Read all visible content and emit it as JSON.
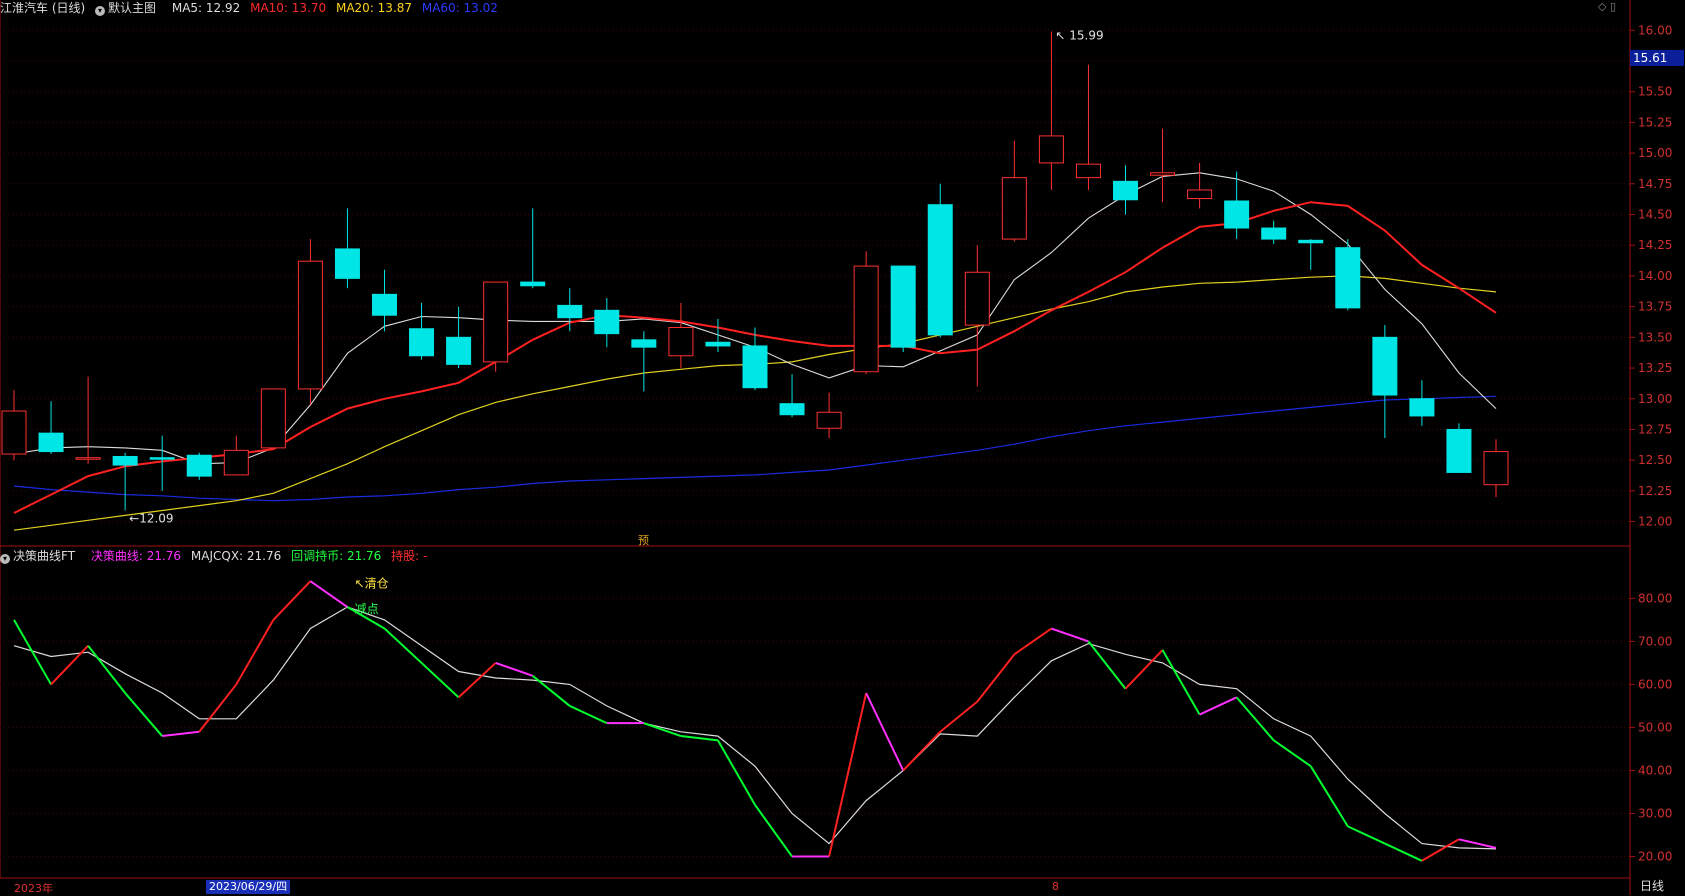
{
  "header_top": {
    "title": "江淮汽车 (日线)",
    "chart_mode": "默认主图",
    "ma5": "MA5: 12.92",
    "ma10": "MA10: 13.70",
    "ma20": "MA20: 13.87",
    "ma60": "MA60: 13.02"
  },
  "header_bottom": {
    "title": "决策曲线FT",
    "jc": "决策曲线: 21.76",
    "majcqx": "MAJCQX: 21.76",
    "hdcb": "回调持币: 21.76",
    "cg": "持股: -"
  },
  "current_price": "15.61",
  "period": "日线",
  "time_labels": {
    "year": "2023年",
    "date": "2023/06/29/四",
    "month": "8"
  },
  "marker_yu": "预",
  "colors": {
    "up": "#ff3030",
    "down": "#00e5e5",
    "ma5": "#dcdcdc",
    "ma10": "#ff2020",
    "ma20": "#e0d020",
    "ma60": "#1a2ae0",
    "grid": "#3a0808",
    "axis": "#a01010",
    "ind_up": "#ff2020",
    "ind_down": "#00ff30",
    "ind_flat": "#ff30ff",
    "ind_ma": "#dcdcdc"
  },
  "chart_data": [
    {
      "type": "candlestick",
      "y_ticks": [
        "16.00",
        "15.75",
        "15.50",
        "15.25",
        "15.00",
        "14.75",
        "14.50",
        "14.25",
        "14.00",
        "13.75",
        "13.50",
        "13.25",
        "13.00",
        "12.75",
        "12.50",
        "12.25",
        "12.00"
      ],
      "ylim": [
        11.85,
        16.1
      ],
      "candles": [
        [
          12.55,
          12.9,
          13.07,
          12.5
        ],
        [
          12.72,
          12.57,
          12.98,
          12.55
        ],
        [
          12.51,
          12.52,
          13.18,
          12.47
        ],
        [
          12.53,
          12.46,
          12.56,
          12.09
        ],
        [
          12.52,
          12.51,
          12.7,
          12.25
        ],
        [
          12.54,
          12.37,
          12.56,
          12.34
        ],
        [
          12.38,
          12.58,
          12.7,
          12.38
        ],
        [
          12.6,
          13.08,
          13.08,
          12.6
        ],
        [
          13.08,
          14.12,
          14.3,
          12.95
        ],
        [
          14.22,
          13.98,
          14.55,
          13.9
        ],
        [
          13.85,
          13.68,
          14.05,
          13.55
        ],
        [
          13.57,
          13.35,
          13.78,
          13.32
        ],
        [
          13.5,
          13.28,
          13.75,
          13.25
        ],
        [
          13.3,
          13.95,
          13.95,
          13.22
        ],
        [
          13.95,
          13.92,
          14.55,
          13.9
        ],
        [
          13.76,
          13.66,
          13.9,
          13.55
        ],
        [
          13.72,
          13.53,
          13.82,
          13.42
        ],
        [
          13.48,
          13.42,
          13.55,
          13.06
        ],
        [
          13.35,
          13.58,
          13.78,
          13.25
        ],
        [
          13.46,
          13.43,
          13.65,
          13.38
        ],
        [
          13.43,
          13.09,
          13.58,
          13.07
        ],
        [
          12.96,
          12.87,
          13.2,
          12.85
        ],
        [
          12.76,
          12.89,
          13.05,
          12.68
        ],
        [
          13.22,
          14.08,
          14.2,
          13.2
        ],
        [
          14.08,
          13.42,
          14.08,
          13.38
        ],
        [
          14.58,
          13.52,
          14.75,
          13.5
        ],
        [
          13.6,
          14.03,
          14.25,
          13.1
        ],
        [
          14.3,
          14.8,
          15.1,
          14.28
        ],
        [
          14.92,
          15.14,
          15.99,
          14.7
        ],
        [
          14.8,
          14.91,
          15.72,
          14.7
        ],
        [
          14.77,
          14.62,
          14.9,
          14.5
        ],
        [
          14.82,
          14.84,
          15.2,
          14.6
        ],
        [
          14.63,
          14.7,
          14.92,
          14.55
        ],
        [
          14.61,
          14.39,
          14.85,
          14.3
        ],
        [
          14.39,
          14.3,
          14.45,
          14.26
        ],
        [
          14.29,
          14.27,
          14.3,
          14.05
        ],
        [
          14.23,
          13.74,
          14.3,
          13.72
        ],
        [
          13.5,
          13.03,
          13.6,
          12.68
        ],
        [
          13.0,
          12.86,
          13.15,
          12.78
        ],
        [
          12.75,
          12.4,
          12.8,
          12.4
        ],
        [
          12.3,
          12.57,
          12.67,
          12.2
        ]
      ],
      "ma5": [
        12.55,
        12.6,
        12.61,
        12.6,
        12.58,
        12.47,
        12.48,
        12.6,
        12.95,
        13.37,
        13.59,
        13.67,
        13.66,
        13.64,
        13.63,
        13.63,
        13.63,
        13.65,
        13.62,
        13.52,
        13.42,
        13.28,
        13.17,
        13.27,
        13.26,
        13.39,
        13.52,
        13.97,
        14.19,
        14.47,
        14.66,
        14.81,
        14.84,
        14.79,
        14.69,
        14.5,
        14.26,
        13.89,
        13.61,
        13.21,
        12.92
      ],
      "ma10": [
        12.07,
        12.22,
        12.37,
        12.45,
        12.49,
        12.52,
        12.55,
        12.59,
        12.77,
        12.92,
        13.0,
        13.06,
        13.13,
        13.3,
        13.48,
        13.62,
        13.68,
        13.66,
        13.63,
        13.58,
        13.52,
        13.47,
        13.43,
        13.43,
        13.43,
        13.37,
        13.4,
        13.55,
        13.72,
        13.87,
        14.03,
        14.23,
        14.4,
        14.43,
        14.53,
        14.6,
        14.57,
        14.37,
        14.09,
        13.9,
        13.7
      ],
      "ma20": [
        11.93,
        11.97,
        12.01,
        12.05,
        12.09,
        12.13,
        12.17,
        12.23,
        12.35,
        12.47,
        12.61,
        12.74,
        12.87,
        12.97,
        13.04,
        13.1,
        13.16,
        13.21,
        13.24,
        13.27,
        13.28,
        13.3,
        13.36,
        13.41,
        13.45,
        13.52,
        13.59,
        13.66,
        13.73,
        13.79,
        13.87,
        13.91,
        13.94,
        13.95,
        13.97,
        13.99,
        14.0,
        13.98,
        13.94,
        13.9,
        13.87
      ],
      "ma60": [
        12.29,
        12.26,
        12.24,
        12.22,
        12.21,
        12.19,
        12.18,
        12.17,
        12.18,
        12.2,
        12.21,
        12.23,
        12.26,
        12.28,
        12.31,
        12.33,
        12.34,
        12.35,
        12.36,
        12.37,
        12.38,
        12.4,
        12.42,
        12.46,
        12.5,
        12.54,
        12.58,
        12.63,
        12.69,
        12.74,
        12.78,
        12.81,
        12.84,
        12.87,
        12.9,
        12.93,
        12.96,
        12.99,
        13.0,
        13.01,
        13.02
      ],
      "annotations": [
        {
          "text": "15.99",
          "index": 28,
          "price": 15.99
        },
        {
          "text": "12.09",
          "index": 3,
          "price": 12.09
        }
      ]
    },
    {
      "type": "line",
      "y_ticks": [
        "80.00",
        "70.00",
        "60.00",
        "50.00",
        "40.00",
        "30.00",
        "20.00"
      ],
      "ylim": [
        15,
        88
      ],
      "jc": [
        75,
        60,
        69,
        58,
        48,
        49,
        60,
        75,
        84,
        78,
        73,
        65,
        57,
        65,
        62,
        55,
        51,
        51,
        48,
        47,
        32,
        20,
        20,
        58,
        40,
        49,
        56,
        67,
        73,
        70,
        59,
        68,
        53,
        57,
        47,
        41,
        27,
        23,
        19,
        24,
        22
      ],
      "majcqx": [
        69,
        66.5,
        67.5,
        62.5,
        58,
        52,
        52,
        61,
        73,
        78,
        75,
        69,
        63,
        61.5,
        61,
        60,
        55,
        51,
        49,
        48,
        41,
        30,
        23,
        33,
        40,
        48.5,
        48,
        57,
        65.5,
        69.5,
        67,
        65,
        60,
        59,
        52,
        48,
        38,
        30,
        23,
        22,
        21.76
      ],
      "annotations": [
        {
          "text": "清仓",
          "index": 9.3,
          "value": 83.5,
          "arrow": "↖"
        },
        {
          "text": "减点",
          "index": 9.3,
          "value": 77.5,
          "arrow": ""
        }
      ]
    }
  ]
}
